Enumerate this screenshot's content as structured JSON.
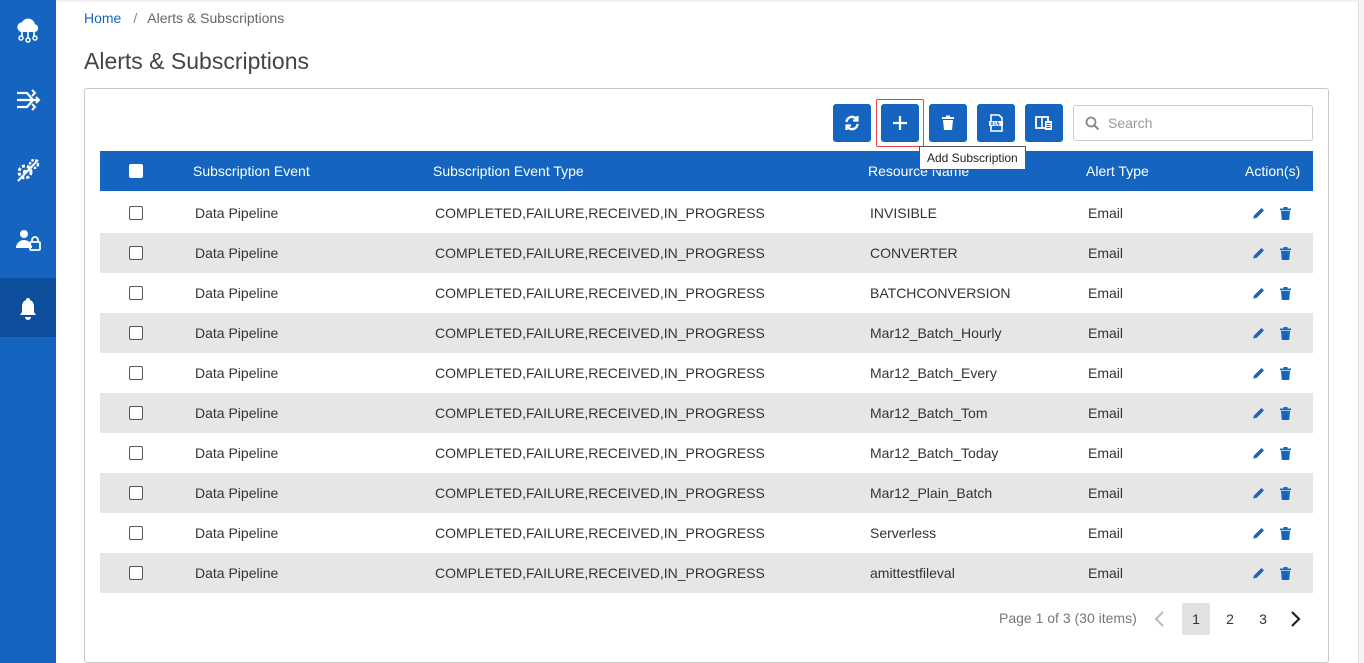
{
  "breadcrumb": {
    "home": "Home",
    "separator": "/",
    "current": "Alerts & Subscriptions"
  },
  "page_title": "Alerts & Subscriptions",
  "sidebar": {
    "items": [
      {
        "icon": "cloud-network-icon"
      },
      {
        "icon": "pipeline-flow-icon"
      },
      {
        "icon": "settings-gears-icon"
      },
      {
        "icon": "user-lock-icon"
      },
      {
        "icon": "bell-icon",
        "active": true
      }
    ]
  },
  "toolbar": {
    "buttons": [
      "refresh-icon",
      "plus-icon",
      "trash-icon",
      "xlsx-export-icon",
      "column-chooser-icon"
    ],
    "tooltip": "Add Subscription",
    "search_placeholder": "Search"
  },
  "table": {
    "headers": [
      "Subscription Event",
      "Subscription Event Type",
      "Resource Name",
      "Alert Type",
      "Action(s)"
    ],
    "rows": [
      {
        "event": "Data Pipeline",
        "type": "COMPLETED,FAILURE,RECEIVED,IN_PROGRESS",
        "resource": "INVISIBLE",
        "alert": "Email"
      },
      {
        "event": "Data Pipeline",
        "type": "COMPLETED,FAILURE,RECEIVED,IN_PROGRESS",
        "resource": "CONVERTER",
        "alert": "Email"
      },
      {
        "event": "Data Pipeline",
        "type": "COMPLETED,FAILURE,RECEIVED,IN_PROGRESS",
        "resource": "BATCHCONVERSION",
        "alert": "Email"
      },
      {
        "event": "Data Pipeline",
        "type": "COMPLETED,FAILURE,RECEIVED,IN_PROGRESS",
        "resource": "Mar12_Batch_Hourly",
        "alert": "Email"
      },
      {
        "event": "Data Pipeline",
        "type": "COMPLETED,FAILURE,RECEIVED,IN_PROGRESS",
        "resource": "Mar12_Batch_Every",
        "alert": "Email"
      },
      {
        "event": "Data Pipeline",
        "type": "COMPLETED,FAILURE,RECEIVED,IN_PROGRESS",
        "resource": "Mar12_Batch_Tom",
        "alert": "Email"
      },
      {
        "event": "Data Pipeline",
        "type": "COMPLETED,FAILURE,RECEIVED,IN_PROGRESS",
        "resource": "Mar12_Batch_Today",
        "alert": "Email"
      },
      {
        "event": "Data Pipeline",
        "type": "COMPLETED,FAILURE,RECEIVED,IN_PROGRESS",
        "resource": "Mar12_Plain_Batch",
        "alert": "Email"
      },
      {
        "event": "Data Pipeline",
        "type": "COMPLETED,FAILURE,RECEIVED,IN_PROGRESS",
        "resource": "Serverless",
        "alert": "Email"
      },
      {
        "event": "Data Pipeline",
        "type": "COMPLETED,FAILURE,RECEIVED,IN_PROGRESS",
        "resource": "amittestfileval",
        "alert": "Email"
      }
    ]
  },
  "pager": {
    "info": "Page 1 of 3 (30 items)",
    "pages": [
      "1",
      "2",
      "3"
    ],
    "current": "1"
  },
  "colors": {
    "primary": "#1565c0",
    "sidebar_active": "#0d4f9c",
    "row_alt": "#e6e6e6",
    "highlight": "#e0474c"
  }
}
